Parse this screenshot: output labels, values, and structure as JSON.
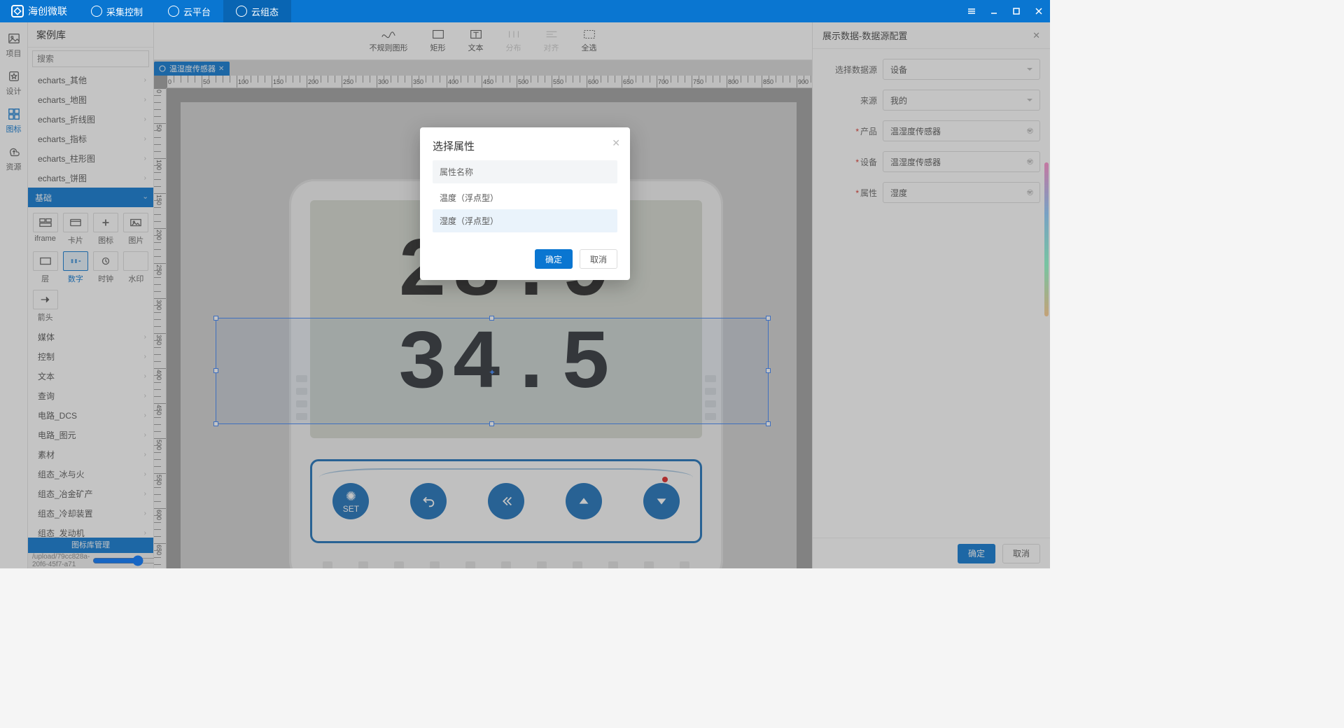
{
  "app": {
    "name": "海创微联"
  },
  "topmenu": {
    "items": [
      {
        "label": "采集控制",
        "active": false
      },
      {
        "label": "云平台",
        "active": false
      },
      {
        "label": "云组态",
        "active": true
      }
    ]
  },
  "leftrail": {
    "items": [
      {
        "label": "项目",
        "active": false
      },
      {
        "label": "设计",
        "active": false
      },
      {
        "label": "图标",
        "active": true
      },
      {
        "label": "资源",
        "active": false
      }
    ]
  },
  "sidepanel": {
    "title": "案例库",
    "search_placeholder": "搜索",
    "categories_top": [
      "echarts_其他",
      "echarts_地图",
      "echarts_折线图",
      "echarts_指标",
      "echarts_柱形图",
      "echarts_饼图"
    ],
    "expanded_cat": "基础",
    "basic_items": [
      {
        "label": "iframe"
      },
      {
        "label": "卡片"
      },
      {
        "label": "图标"
      },
      {
        "label": "图片"
      },
      {
        "label": "层"
      },
      {
        "label": "数字",
        "active": true
      },
      {
        "label": "时钟"
      },
      {
        "label": "水印"
      },
      {
        "label": "箭头"
      }
    ],
    "categories_bottom": [
      "媒体",
      "控制",
      "文本",
      "查询",
      "电路_DCS",
      "电路_图元",
      "素材",
      "组态_冰与火",
      "组态_冶金矿产",
      "组态_冷却装置",
      "组态_发动机"
    ],
    "footer": "图标库管理",
    "path": "/upload/79cc828a-20f6-45f7-a71",
    "zoom": "1"
  },
  "toolbar": {
    "items": [
      {
        "label": "不规则图形",
        "disabled": false
      },
      {
        "label": "矩形",
        "disabled": false
      },
      {
        "label": "文本",
        "disabled": false
      },
      {
        "label": "分布",
        "disabled": true
      },
      {
        "label": "对齐",
        "disabled": true
      },
      {
        "label": "全选",
        "disabled": false
      }
    ]
  },
  "tabs": {
    "open": [
      {
        "label": "温湿度传感器"
      }
    ]
  },
  "canvas": {
    "lcd_line1": "28.9",
    "lcd_line2": "34.5",
    "set_label": "SET"
  },
  "rightpanel": {
    "title": "展示数据-数据源配置",
    "fields": {
      "select_source_label": "选择数据源",
      "select_source_value": "设备",
      "origin_label": "来源",
      "origin_value": "我的",
      "product_label": "产品",
      "product_value": "温湿度传感器",
      "device_label": "设备",
      "device_value": "温湿度传感器",
      "attr_label": "属性",
      "attr_value": "湿度"
    },
    "ok": "确定",
    "cancel": "取消"
  },
  "modal": {
    "title": "选择属性",
    "col_head": "属性名称",
    "rows": [
      {
        "label": "温度（浮点型）",
        "selected": false
      },
      {
        "label": "湿度（浮点型）",
        "selected": true
      }
    ],
    "ok": "确定",
    "cancel": "取消"
  }
}
